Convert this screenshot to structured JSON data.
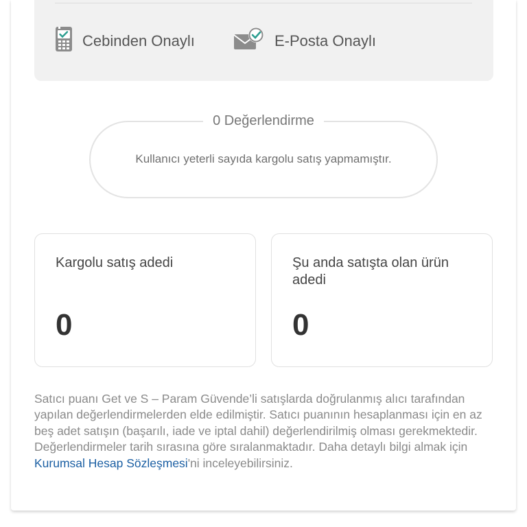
{
  "verification": {
    "phone_label": "Cebinden Onaylı",
    "email_label": "E-Posta Onaylı",
    "phone_icon": "phone-check-icon",
    "email_icon": "mail-check-icon"
  },
  "rating": {
    "title": "0 Değerlendirme",
    "message": "Kullanıcı yeterli sayıda kargolu satış yapmamıştır."
  },
  "stats": {
    "shipped_sales": {
      "label": "Kargolu satış adedi",
      "value": "0"
    },
    "products_on_sale": {
      "label": "Şu anda satışta olan ürün adedi",
      "value": "0"
    }
  },
  "info": {
    "text_before_link": "Satıcı puanı Get ve S – Param Güvende’li satışlarda doğrulanmış alıcı tarafından yapılan değerlendirmelerden elde edilmiştir. Satıcı puanının hesaplanması için en az beş adet satışın (başarılı, iade ve iptal dahil) değerlendirilmiş olması gerekmektedir. Değerlendirmeler tarih sırasına göre sıralanmaktadır. Daha detaylı bilgi almak için ",
    "link_text": "Kurumsal Hesap Sözleşmesi",
    "text_after_link": "'ni inceleyebilirsiniz."
  },
  "colors": {
    "link": "#1b5fa3",
    "check": "#2a9d8f",
    "icon_gray": "#8c8c8c"
  }
}
